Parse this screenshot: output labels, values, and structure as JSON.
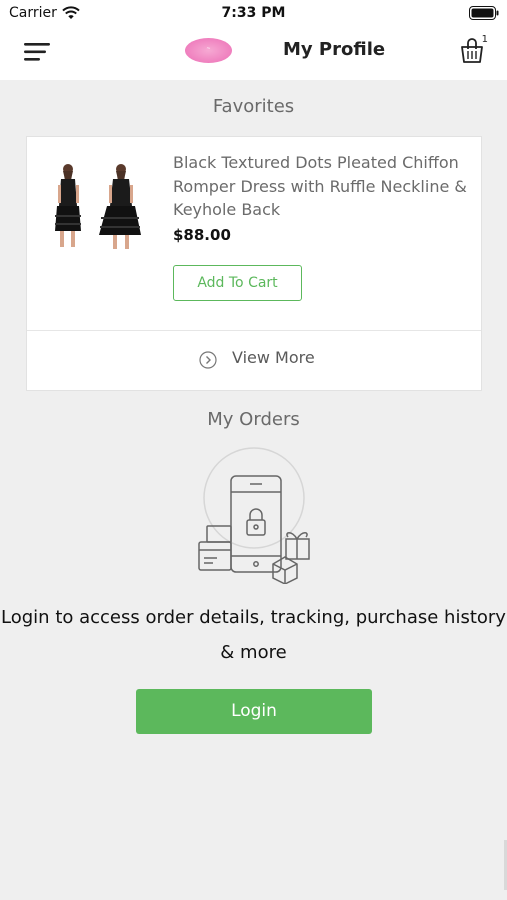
{
  "status_bar": {
    "carrier": "Carrier",
    "time": "7:33 PM"
  },
  "header": {
    "title": "My Profile",
    "cart_count": "1"
  },
  "favorites": {
    "title": "Favorites",
    "product": {
      "name": "Black Textured Dots Pleated Chiffon Romper Dress with Ruffle Neckline & Keyhole Back",
      "price": "$88.00",
      "add_to_cart_label": "Add To Cart"
    },
    "view_more_label": "View More"
  },
  "orders": {
    "title": "My Orders",
    "message": "Login to access order details, tracking, purchase history & more",
    "login_label": "Login"
  },
  "colors": {
    "accent": "#5cb85c",
    "logo": "#ef7fbe",
    "background": "#efefef"
  },
  "icons": [
    "wifi-icon",
    "battery-icon",
    "menu-icon",
    "cart-icon",
    "chevron-right-circle-icon",
    "phone-lock-illustration"
  ]
}
